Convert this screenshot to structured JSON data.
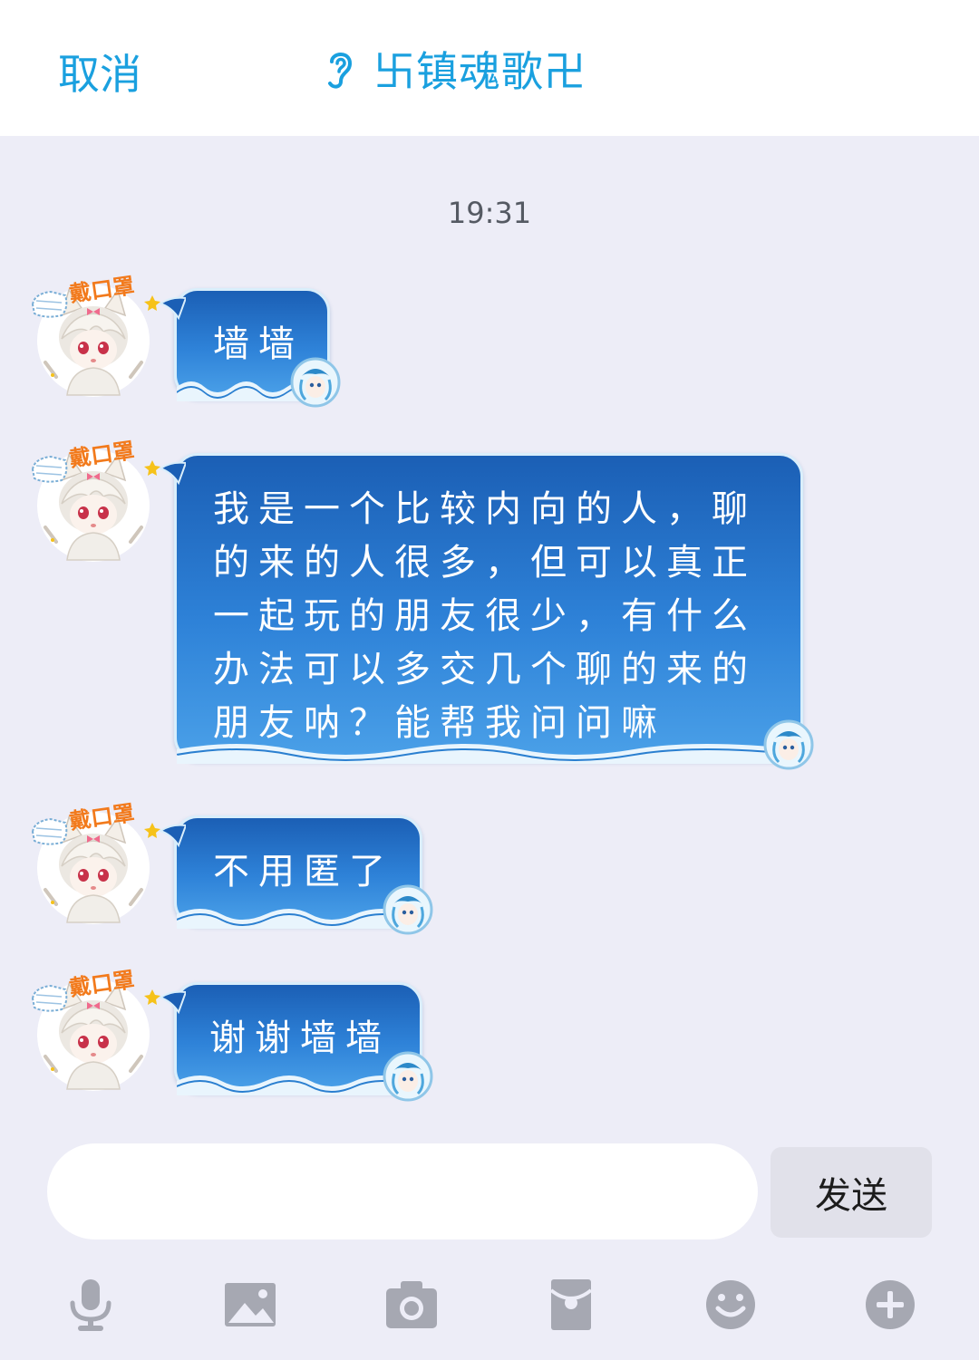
{
  "header": {
    "cancel_label": "取消",
    "title": "卐镇魂歌卍",
    "listen_icon": "ear-icon"
  },
  "chat": {
    "timestamp": "19:31",
    "avatar_badge_text": "戴口罩",
    "messages": [
      {
        "lines": [
          "墙墙"
        ]
      },
      {
        "lines": [
          "我是一个比较内向的人，聊",
          "的来的人很多，但可以真正",
          "一起玩的朋友很少，有什么",
          "办法可以多交几个聊的来的",
          "朋友呐？能帮我问问嘛"
        ]
      },
      {
        "lines": [
          "不用匿了"
        ]
      },
      {
        "lines": [
          "谢谢墙墙"
        ]
      }
    ]
  },
  "composer": {
    "input_value": "",
    "send_label": "发送"
  },
  "toolbar": {
    "icons": [
      "microphone-icon",
      "image-icon",
      "camera-icon",
      "red-packet-icon",
      "emoji-icon",
      "plus-icon"
    ]
  },
  "colors": {
    "accent": "#1aa0df",
    "background": "#ededf7",
    "bubble_top": "#1b5fb5",
    "bubble_bottom": "#4aa0e8",
    "icon_gray": "#a6a8b2",
    "badge_orange": "#f27a1c"
  }
}
